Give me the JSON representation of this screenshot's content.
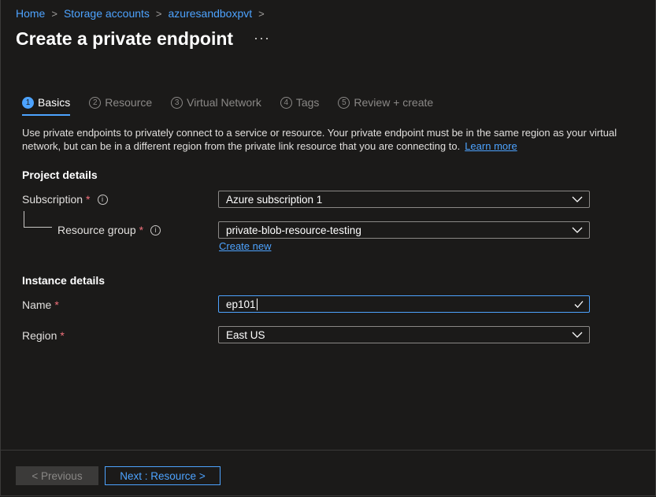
{
  "breadcrumb": [
    "Home",
    "Storage accounts",
    "azuresandboxpvt"
  ],
  "page": {
    "title": "Create a private endpoint",
    "more": "···"
  },
  "tabs": [
    {
      "num": "1",
      "label": "Basics"
    },
    {
      "num": "2",
      "label": "Resource"
    },
    {
      "num": "3",
      "label": "Virtual Network"
    },
    {
      "num": "4",
      "label": "Tags"
    },
    {
      "num": "5",
      "label": "Review + create"
    }
  ],
  "description": {
    "text": "Use private endpoints to privately connect to a service or resource. Your private endpoint must be in the same region as your virtual network, but can be in a different region from the private link resource that you are connecting to.",
    "link": "Learn more"
  },
  "project": {
    "heading": "Project details",
    "subscription_label": "Subscription",
    "subscription_value": "Azure subscription 1",
    "resource_group_label": "Resource group",
    "resource_group_value": "private-blob-resource-testing",
    "create_new": "Create new"
  },
  "instance": {
    "heading": "Instance details",
    "name_label": "Name",
    "name_value": "ep101",
    "region_label": "Region",
    "region_value": "East US"
  },
  "required_marker": "*",
  "info_glyph": "i",
  "footer": {
    "previous": "< Previous",
    "next": "Next : Resource >"
  },
  "colors": {
    "accent": "#4da3ff",
    "background": "#1b1a19",
    "required": "#f1707b"
  }
}
